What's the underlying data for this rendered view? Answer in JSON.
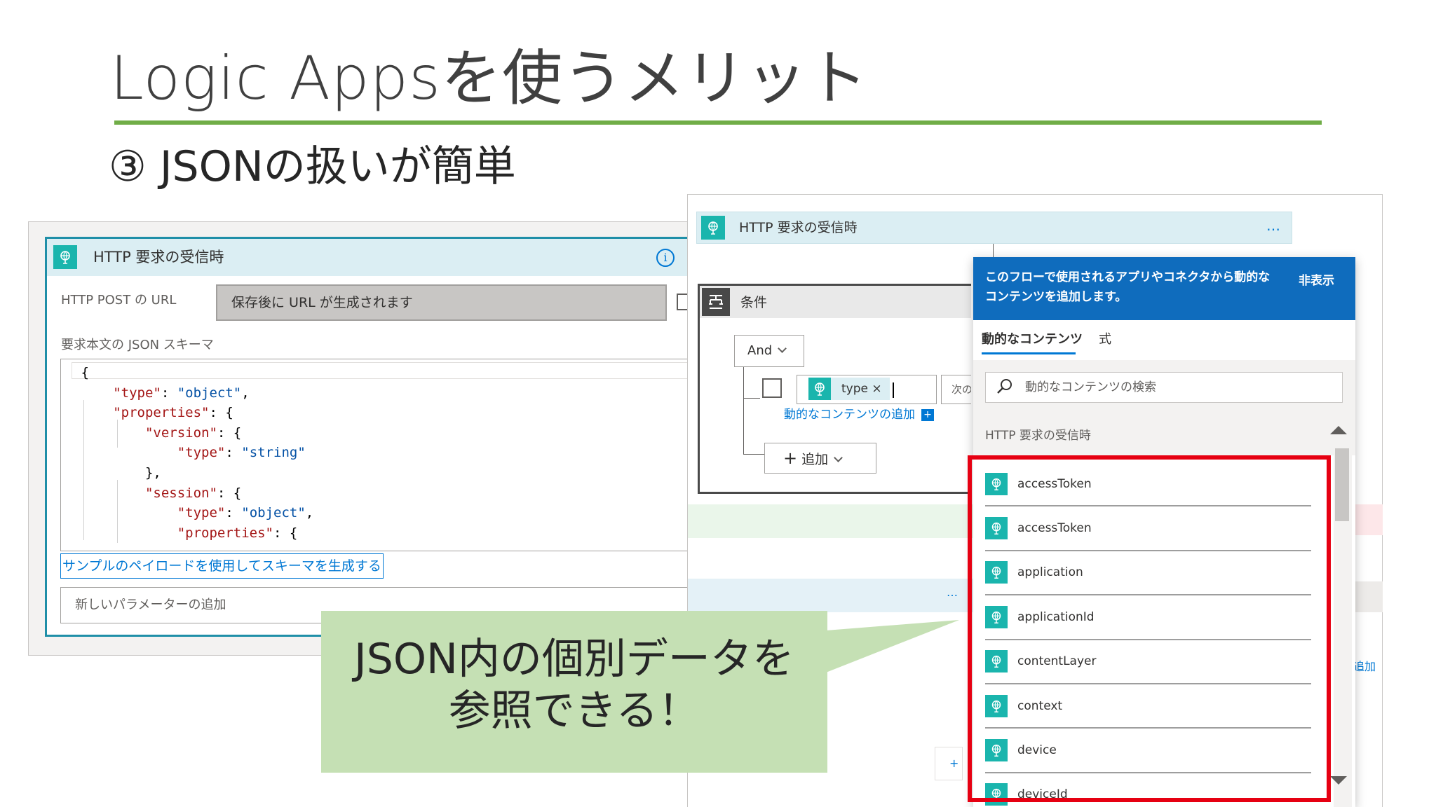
{
  "slide": {
    "title": "Logic Appsを使うメリット",
    "subtitle": "③ JSONの扱いが簡単"
  },
  "left_card": {
    "title": "HTTP 要求の受信時",
    "info_icon": "i",
    "url_label": "HTTP POST の URL",
    "url_value": "保存後に URL が生成されます",
    "schema_label": "要求本文の JSON スキーマ",
    "schema_lines": [
      {
        "indent": 0,
        "key": "",
        "rest": "{"
      },
      {
        "indent": 1,
        "key": "\"type\"",
        "rest": ": ",
        "value": "\"object\"",
        "tail": ","
      },
      {
        "indent": 1,
        "key": "\"properties\"",
        "rest": ": {"
      },
      {
        "indent": 2,
        "key": "\"version\"",
        "rest": ": {"
      },
      {
        "indent": 3,
        "key": "\"type\"",
        "rest": ": ",
        "value": "\"string\"",
        "tail": ""
      },
      {
        "indent": 2,
        "key": "",
        "rest": "},"
      },
      {
        "indent": 2,
        "key": "\"session\"",
        "rest": ": {"
      },
      {
        "indent": 3,
        "key": "\"type\"",
        "rest": ": ",
        "value": "\"object\"",
        "tail": ","
      },
      {
        "indent": 3,
        "key": "\"properties\"",
        "rest": ": {"
      }
    ],
    "sample_link": "サンプルのペイロードを使用してスキーマを生成する",
    "param_placeholder": "新しいパラメーターの追加"
  },
  "right_flow": {
    "trigger_title": "HTTP 要求の受信時",
    "trigger_more": "…",
    "condition_title": "条件",
    "and_label": "And",
    "token_label": "type",
    "token_remove": "×",
    "next_partial": "次の",
    "dynamic_add_link": "動的なコンテンツの追加",
    "dynamic_add_plus": "+",
    "add_button": "追加",
    "scope_more": "…",
    "bottom_add": "+",
    "edge_link": "追加"
  },
  "dynamic_panel": {
    "description": "このフローで使用されるアプリやコネクタから動的なコンテンツを追加します。",
    "hide_label": "非表示",
    "tab_dynamic": "動的なコンテンツ",
    "tab_expression": "式",
    "search_placeholder": "動的なコンテンツの検索",
    "section_title": "HTTP 要求の受信時",
    "items": [
      "accessToken",
      "accessToken",
      "application",
      "applicationId",
      "contentLayer",
      "context",
      "device",
      "deviceId"
    ]
  },
  "callout": {
    "line1": "JSON内の個別データを",
    "line2": "参照できる！"
  },
  "colors": {
    "title_rule": "#70ad47",
    "highlight": "#e60012",
    "callout": "#c5e0b4",
    "panel_header": "#0f6cbd",
    "trigger_icon": "#1ab5ad"
  },
  "icons": {
    "trigger": "globe-request-icon",
    "condition": "condition-icon",
    "search": "search-icon"
  }
}
